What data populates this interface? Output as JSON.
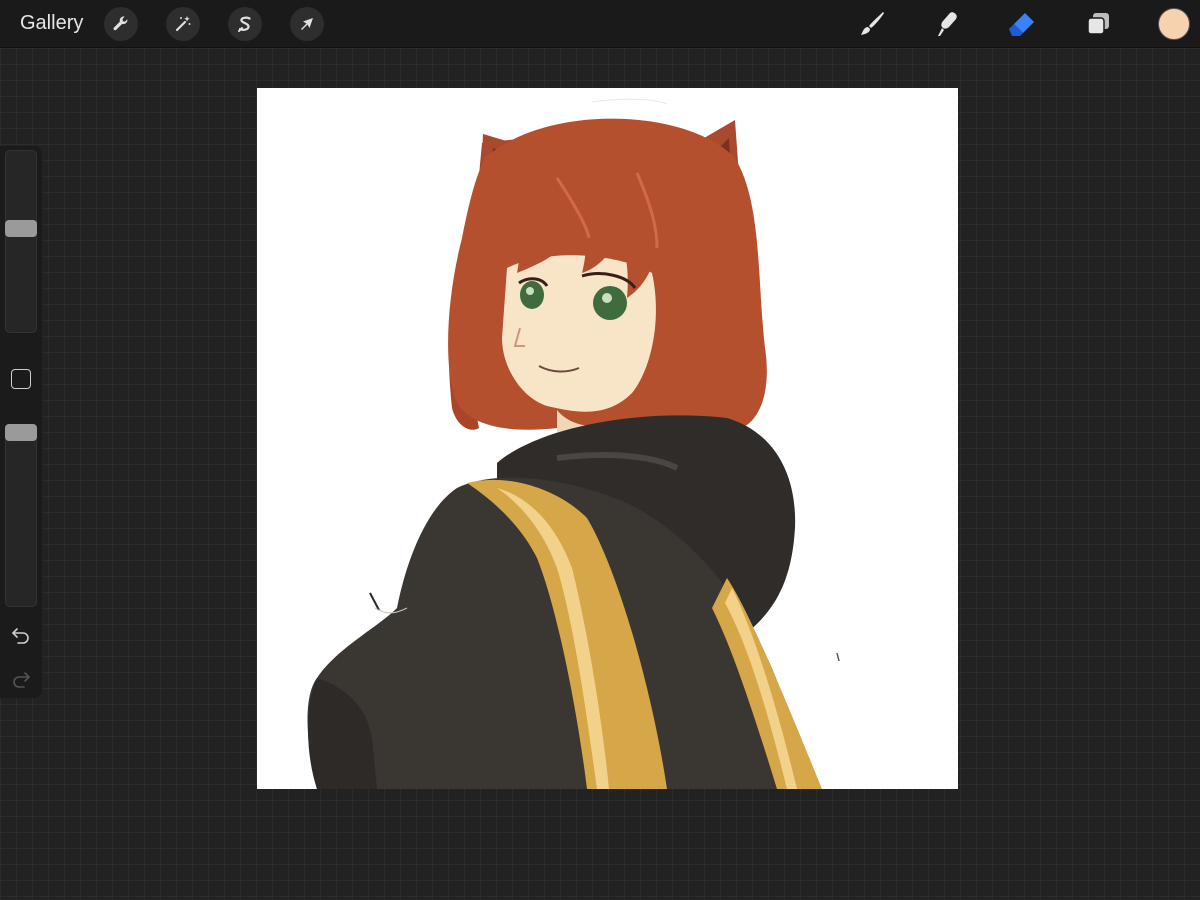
{
  "topbar": {
    "gallery_label": "Gallery",
    "left_tools": [
      {
        "name": "actions",
        "icon": "wrench-icon"
      },
      {
        "name": "adjustments",
        "icon": "magic-wand-icon"
      },
      {
        "name": "selection",
        "icon": "selection-s-icon"
      },
      {
        "name": "transform",
        "icon": "arrow-cursor-icon"
      }
    ],
    "right_tools": [
      {
        "name": "brush",
        "icon": "brush-icon",
        "active": false
      },
      {
        "name": "smudge",
        "icon": "smudge-icon",
        "active": false
      },
      {
        "name": "eraser",
        "icon": "eraser-icon",
        "active": true
      },
      {
        "name": "layers",
        "icon": "layers-icon",
        "active": false
      }
    ],
    "current_color": "#f6d3ae"
  },
  "sidebar": {
    "brush_size_level": 0.58,
    "opacity_level": 1.0,
    "icons": [
      "modify-square-icon",
      "undo-icon",
      "redo-icon"
    ]
  },
  "colors": {
    "accent": "#3b82f6",
    "hair": "#b5502f",
    "skin": "#f8e5c8",
    "cloak": "#3a3733",
    "gold": "#d6a748",
    "eyes": "#3f6b3f"
  }
}
